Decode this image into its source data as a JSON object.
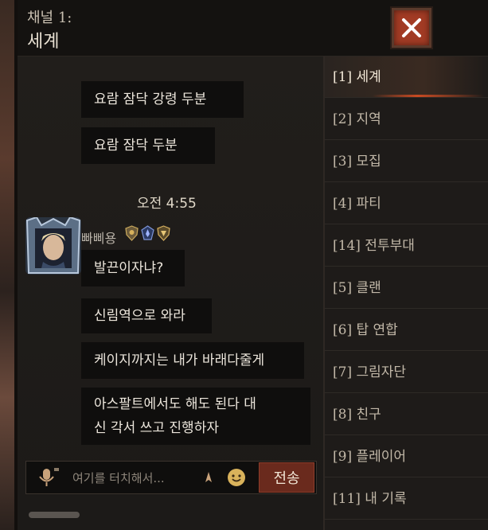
{
  "header": {
    "channel_label": "채널 1:",
    "channel_name": "세계",
    "close_icon": "close-x-icon"
  },
  "chat": {
    "messages_before": [
      {
        "text": "요람 잠닥 강령 두분"
      },
      {
        "text": "요람 잠닥  두분"
      }
    ],
    "timestamp": "오전 4:55",
    "user": {
      "name": "빠삐용",
      "badges": [
        "shield-badge-icon",
        "blue-emblem-icon",
        "gold-emblem-icon"
      ]
    },
    "messages": [
      {
        "text": "발끈이자냐?"
      },
      {
        "text": "신림역으로 와라"
      },
      {
        "text": "케이지까지는 내가 바래다줄게"
      },
      {
        "text": "아스팔트에서도 해도 된다 대"
      },
      {
        "text": "신 각서 쓰고 진행하자"
      }
    ]
  },
  "input": {
    "placeholder": "여기를 터치해서...",
    "send_label": "전송",
    "mic_icon": "voice-mic-icon",
    "emoji_icon": "emoji-icon",
    "arrow_icon": "arrow-up-icon"
  },
  "channels": [
    {
      "label": "[1] 세계",
      "active": true
    },
    {
      "label": "[2] 지역"
    },
    {
      "label": "[3] 모집"
    },
    {
      "label": "[4] 파티"
    },
    {
      "label": "[14] 전투부대"
    },
    {
      "label": "[5] 클랜"
    },
    {
      "label": "[6] 탑 연합"
    },
    {
      "label": "[7] 그림자단"
    },
    {
      "label": "[8] 친구"
    },
    {
      "label": "[9] 플레이어"
    },
    {
      "label": "[11] 내 기록"
    }
  ],
  "colors": {
    "accent": "#a23b24",
    "send_button": "#6a2a1d",
    "panel": "#1e1b19"
  }
}
